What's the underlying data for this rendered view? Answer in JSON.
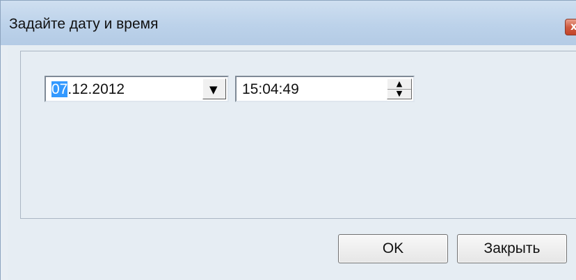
{
  "window": {
    "title": "Задайте дату и время",
    "close_glyph": "x"
  },
  "date_picker": {
    "day_selected": "07",
    "rest": ".12.2012",
    "dropdown_icon": "▼"
  },
  "time_picker": {
    "value": "15:04:49",
    "spin_up": "▲",
    "spin_down": "▼"
  },
  "buttons": {
    "ok": "OK",
    "close": "Закрыть"
  },
  "colors": {
    "selection": "#3399ff",
    "close_button": "#c9503a",
    "titlebar": "#bcd2ea"
  }
}
